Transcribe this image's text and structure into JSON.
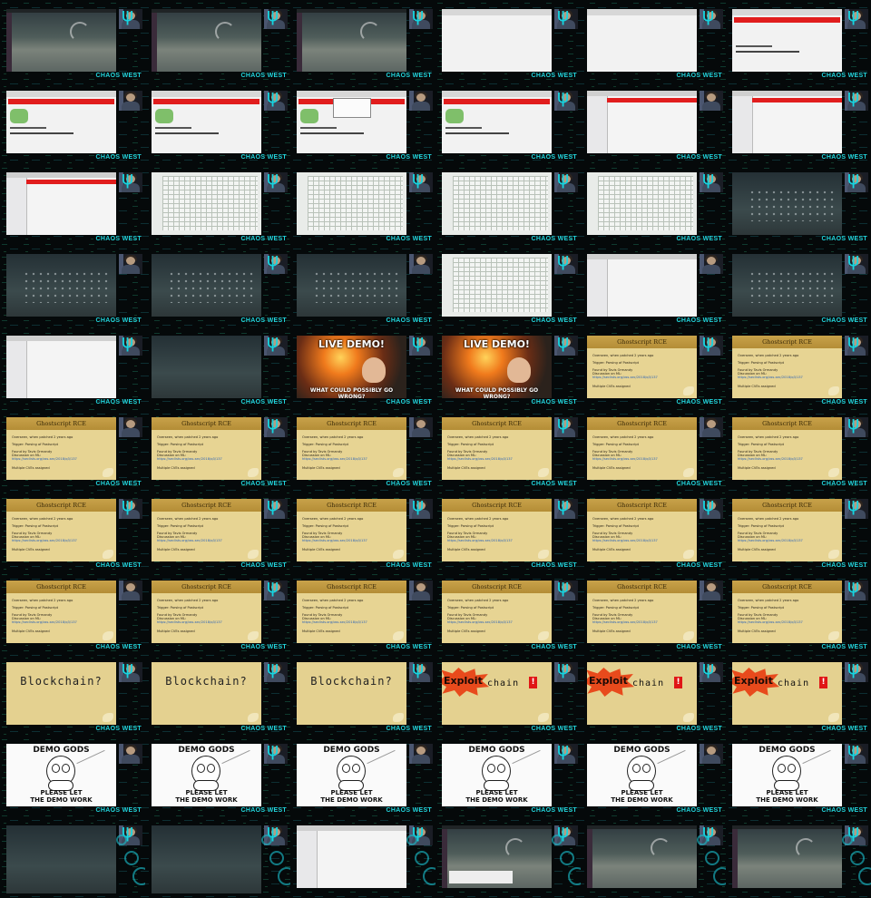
{
  "brand": {
    "label": "CHAOS WEST",
    "accent_color": "#22d4dc",
    "background_color": "#05090a"
  },
  "texts": {
    "live_demo_top": "LIVE DEMO!",
    "live_demo_bottom": "WHAT COULD POSSIBLY GO WRONG?",
    "gs_title": "Ghostscript RCE",
    "gs_line1": "Overseen, when patched 2 years ago",
    "gs_line2": "Trigger: Parsing of Postscript",
    "gs_line3": "Found by Tavis Ormandy",
    "gs_line4": "Discussion on ML:",
    "gs_link": "https://seclists.org/oss-sec/2018/q3/137",
    "gs_line5": "Multiple CVEs assigned",
    "blockchain": "Blockchain?",
    "exploit": "Exploit",
    "chain": "chain",
    "bang": "!",
    "demo_top": "DEMO GODS",
    "demo_bottom1": "PLEASE LET",
    "demo_bottom2": "THE DEMO WORK"
  },
  "cells": [
    "desktop",
    "desktop",
    "desktop",
    "browser-blank",
    "browser-blank",
    "browser-red",
    "browser-frog",
    "browser-frog",
    "browser-dialog",
    "browser-frog",
    "file-dialog",
    "file-dialog",
    "file-dialog",
    "spreadsheet",
    "spreadsheet",
    "spreadsheet",
    "spreadsheet",
    "dark-grid",
    "dark-grid",
    "dark-grid",
    "dark-apps",
    "spreadsheet-window",
    "light-window",
    "dark-grid",
    "editor",
    "dark-desktop",
    "live-demo",
    "live-demo",
    "ghostscript",
    "ghostscript",
    "ghostscript",
    "ghostscript",
    "ghostscript",
    "ghostscript",
    "ghostscript",
    "ghostscript",
    "ghostscript",
    "ghostscript",
    "ghostscript",
    "ghostscript",
    "ghostscript",
    "ghostscript",
    "ghostscript",
    "ghostscript",
    "ghostscript",
    "ghostscript",
    "ghostscript",
    "ghostscript",
    "blockchain",
    "blockchain",
    "blockchain",
    "exploit",
    "exploit",
    "exploit",
    "demo-gods",
    "demo-gods",
    "demo-gods",
    "demo-gods",
    "demo-gods",
    "demo-gods",
    "dark-desktop-tall",
    "dark-desktop-tall",
    "light-window",
    "desktop-dialog",
    "desktop",
    "desktop"
  ]
}
